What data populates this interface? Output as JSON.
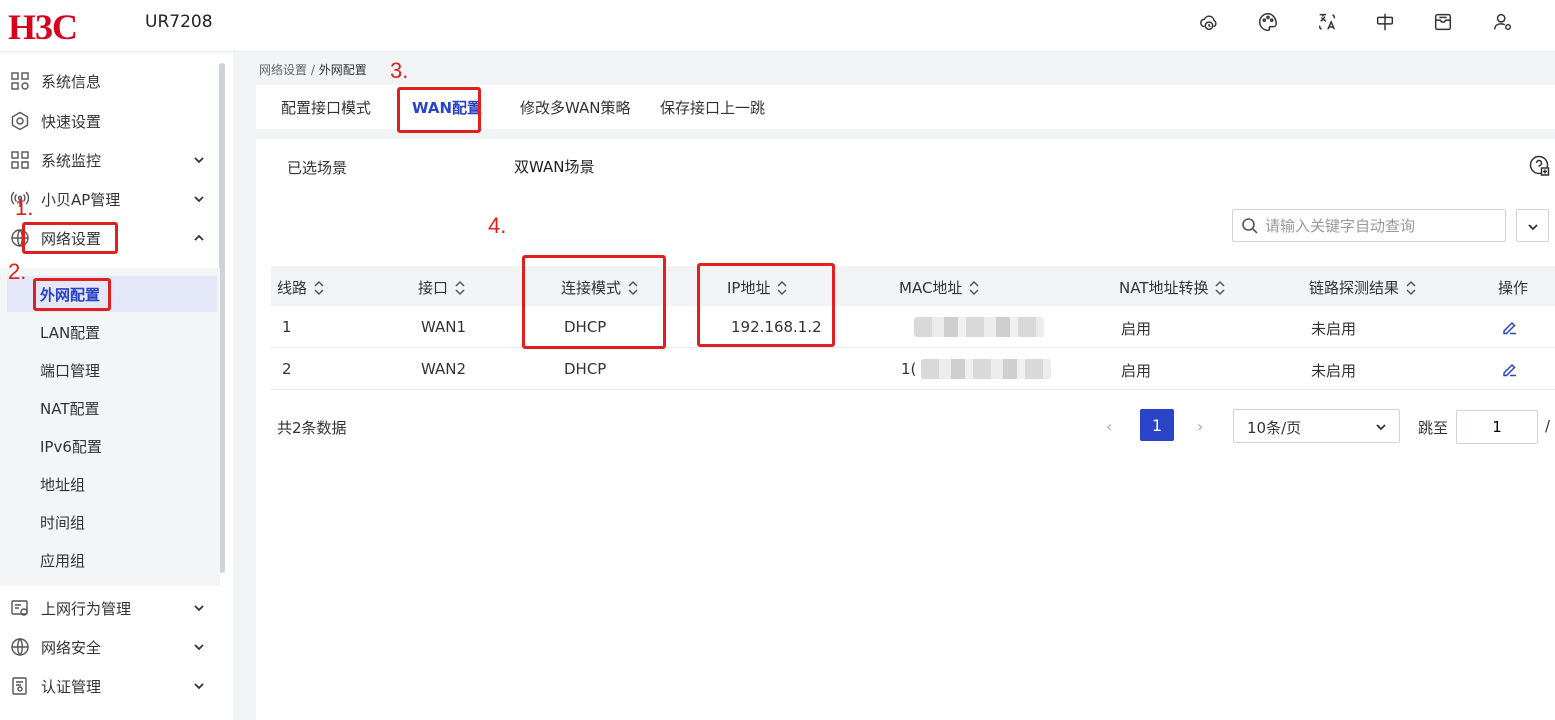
{
  "header": {
    "logo": "H3C",
    "model": "UR7208",
    "icons": [
      "cloud-clock-icon",
      "palette-icon",
      "translate-icon",
      "flag-icon",
      "inbox-icon",
      "user-settings-icon"
    ]
  },
  "sidebar": {
    "items": [
      {
        "label": "系统信息",
        "icon": "system-info-icon"
      },
      {
        "label": "快速设置",
        "icon": "quick-setup-icon"
      },
      {
        "label": "系统监控",
        "icon": "monitor-icon"
      },
      {
        "label": "小贝AP管理",
        "icon": "ap-signal-icon"
      },
      {
        "label": "网络设置",
        "icon": "globe-icon"
      },
      {
        "label": "上网行为管理",
        "icon": "behavior-icon"
      },
      {
        "label": "网络安全",
        "icon": "security-globe-icon"
      },
      {
        "label": "认证管理",
        "icon": "auth-icon"
      }
    ],
    "submenu": [
      "外网配置",
      "LAN配置",
      "端口管理",
      "NAT配置",
      "IPv6配置",
      "地址组",
      "时间组",
      "应用组"
    ]
  },
  "annotations": [
    "1.",
    "2.",
    "3.",
    "4."
  ],
  "breadcrumb": {
    "parent": "网络设置",
    "separator": "/",
    "current": "外网配置"
  },
  "tabs": [
    "配置接口模式",
    "WAN配置",
    "修改多WAN策略",
    "保存接口上一跳"
  ],
  "scene": {
    "label": "已选场景",
    "value": "双WAN场景"
  },
  "search": {
    "placeholder": "请输入关键字自动查询"
  },
  "table": {
    "columns": [
      "线路",
      "接口",
      "连接模式",
      "IP地址",
      "MAC地址",
      "NAT地址转换",
      "链路探测结果",
      "操作"
    ],
    "rows": [
      {
        "line": "1",
        "iface": "WAN1",
        "mode": "DHCP",
        "ip": "192.168.1.2",
        "mac": "",
        "nat": "启用",
        "probe": "未启用"
      },
      {
        "line": "2",
        "iface": "WAN2",
        "mode": "DHCP",
        "ip": "",
        "mac": "1(",
        "nat": "启用",
        "probe": "未启用"
      }
    ]
  },
  "pagination": {
    "total": "共2条数据",
    "current_page": "1",
    "page_size": "10条/页",
    "jump_label": "跳至",
    "jump_value": "1",
    "slash": "/"
  },
  "colors": {
    "brand": "#d9001b",
    "accent": "#2a43c7",
    "annotation": "#e0201e"
  }
}
